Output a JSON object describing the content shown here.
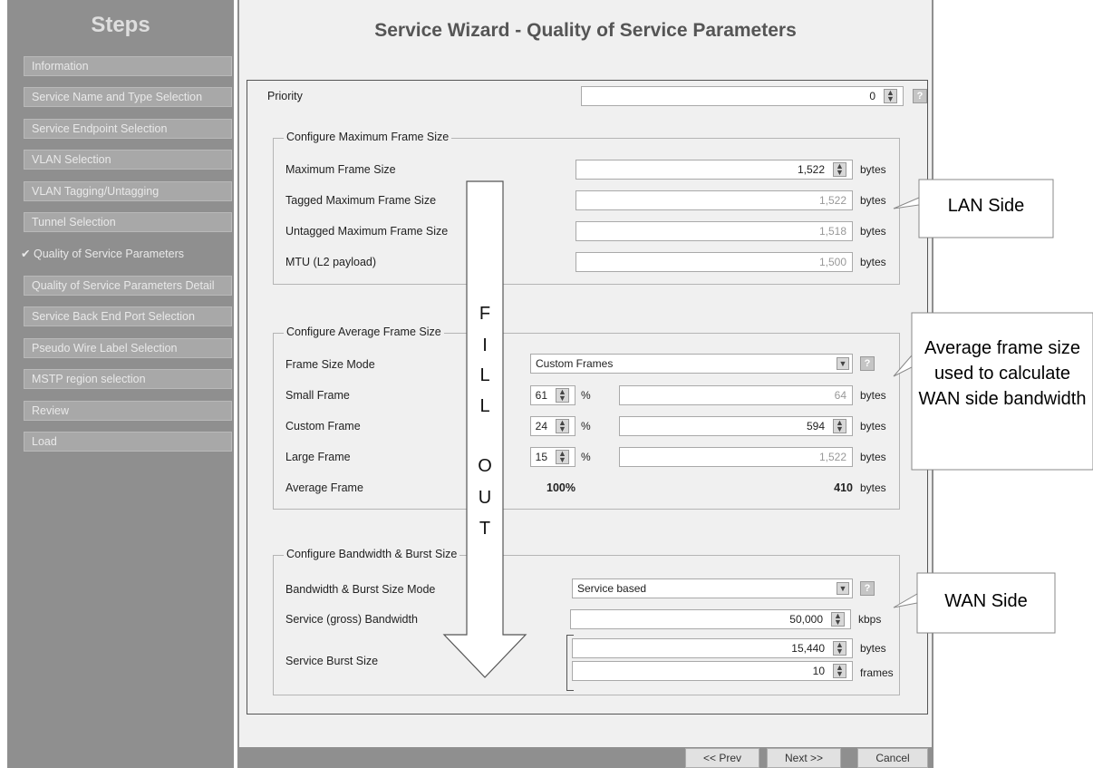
{
  "sidebar": {
    "title": "Steps",
    "items": [
      {
        "label": "Information"
      },
      {
        "label": "Service Name and Type Selection"
      },
      {
        "label": "Service Endpoint Selection"
      },
      {
        "label": "VLAN Selection"
      },
      {
        "label": "VLAN Tagging/Untagging"
      },
      {
        "label": "Tunnel Selection"
      },
      {
        "label": "Quality of Service Parameters",
        "active": true,
        "check": "✔"
      },
      {
        "label": "Quality of Service Parameters Detail"
      },
      {
        "label": "Service Back End Port Selection"
      },
      {
        "label": "Pseudo Wire Label Selection"
      },
      {
        "label": "MSTP region selection"
      },
      {
        "label": "Review"
      },
      {
        "label": "Load"
      }
    ]
  },
  "main": {
    "title": "Service Wizard - Quality of Service Parameters",
    "priority": {
      "label": "Priority",
      "value": "0"
    },
    "max_frame": {
      "legend": "Configure Maximum Frame Size",
      "rows": [
        {
          "label": "Maximum Frame Size",
          "value": "1,522",
          "unit": "bytes"
        },
        {
          "label": "Tagged Maximum Frame Size",
          "value": "1,522",
          "unit": "bytes"
        },
        {
          "label": "Untagged Maximum Frame Size",
          "value": "1,518",
          "unit": "bytes"
        },
        {
          "label": "MTU (L2 payload)",
          "value": "1,500",
          "unit": "bytes"
        }
      ]
    },
    "avg_frame": {
      "legend": "Configure Average Frame Size",
      "mode_label": "Frame Size Mode",
      "mode_value": "Custom Frames",
      "rows": [
        {
          "label": "Small Frame",
          "pct": "61",
          "pct_unit": "%",
          "value": "64",
          "unit": "bytes"
        },
        {
          "label": "Custom Frame",
          "pct": "24",
          "pct_unit": "%",
          "value": "594",
          "unit": "bytes"
        },
        {
          "label": "Large Frame",
          "pct": "15",
          "pct_unit": "%",
          "value": "1,522",
          "unit": "bytes"
        }
      ],
      "average": {
        "label": "Average Frame",
        "pct": "100%",
        "value": "410",
        "unit": "bytes"
      }
    },
    "bandwidth": {
      "legend": "Configure Bandwidth & Burst Size",
      "mode_label": "Bandwidth & Burst Size Mode",
      "mode_value": "Service based",
      "bw_label": "Service (gross) Bandwidth",
      "bw_value": "50,000",
      "bw_unit": "kbps",
      "burst_label": "Service Burst Size",
      "burst_bytes": "15,440",
      "burst_bytes_unit": "bytes",
      "burst_frames": "10",
      "burst_frames_unit": "frames"
    },
    "buttons": {
      "prev": "<< Prev",
      "next": "Next >>",
      "cancel": "Cancel"
    }
  },
  "annotations": {
    "fill_out": [
      "F",
      "I",
      "L",
      "L",
      "O",
      "U",
      "T"
    ],
    "lan_side": "LAN Side",
    "avg_note": "Average frame size used to calculate WAN side bandwidth",
    "wan_side": "WAN Side"
  },
  "icons": {
    "spin": "spinner-icon",
    "help": "help-icon",
    "dropdown": "chevron-down-icon",
    "check": "check-icon"
  }
}
